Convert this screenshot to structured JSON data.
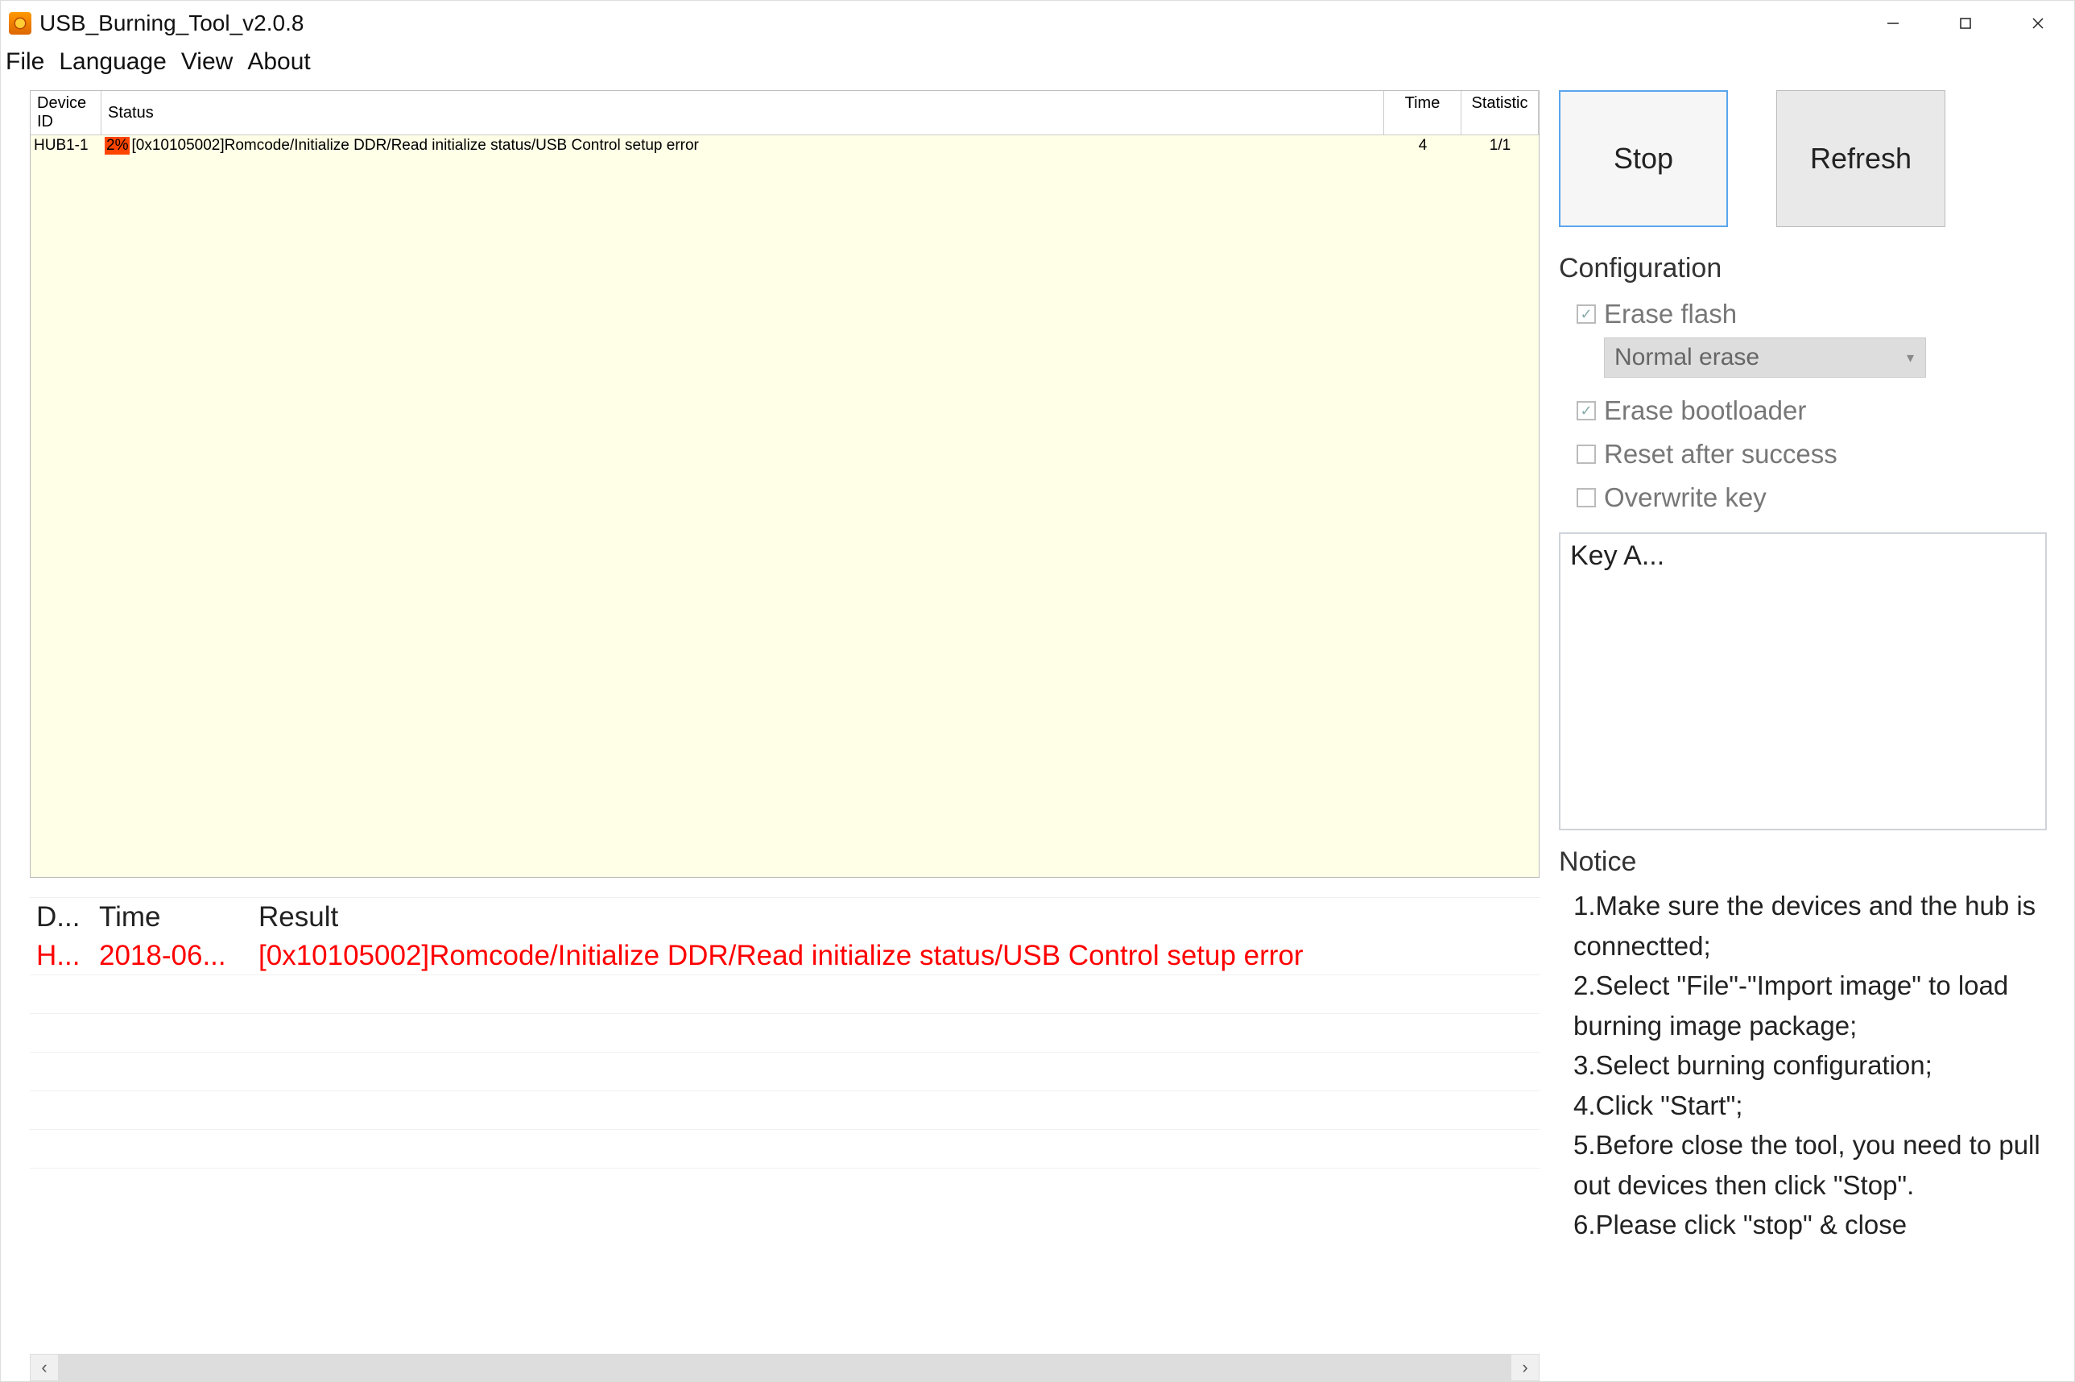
{
  "window": {
    "title": "USB_Burning_Tool_v2.0.8"
  },
  "menubar": {
    "file": "File",
    "language": "Language",
    "view": "View",
    "about": "About"
  },
  "device_table": {
    "headers": {
      "id": "Device ID",
      "status": "Status",
      "time": "Time",
      "statistic": "Statistic"
    },
    "rows": [
      {
        "id": "HUB1-1",
        "percent": "2%",
        "status_text": "[0x10105002]Romcode/Initialize DDR/Read initialize status/USB Control setup error",
        "time": "4",
        "statistic": "1/1"
      }
    ]
  },
  "log_table": {
    "headers": {
      "d": "D...",
      "time": "Time",
      "result": "Result"
    },
    "rows": [
      {
        "d": "H...",
        "time": "2018-06...",
        "result": "[0x10105002]Romcode/Initialize DDR/Read initialize status/USB Control setup error"
      }
    ]
  },
  "buttons": {
    "stop": "Stop",
    "refresh": "Refresh"
  },
  "config": {
    "title": "Configuration",
    "erase_flash": "Erase flash",
    "erase_mode": "Normal erase",
    "erase_bootloader": "Erase bootloader",
    "reset_after": "Reset after success",
    "overwrite_key": "Overwrite key"
  },
  "keybox": {
    "label": "Key A..."
  },
  "notice": {
    "title": "Notice",
    "lines": [
      "1.Make sure the devices and the hub is connectted;",
      "2.Select \"File\"-\"Import image\" to load burning image package;",
      "3.Select burning configuration;",
      "4.Click \"Start\";",
      "5.Before close the tool, you need to pull out devices then click \"Stop\".",
      "6.Please click \"stop\" & close"
    ]
  }
}
